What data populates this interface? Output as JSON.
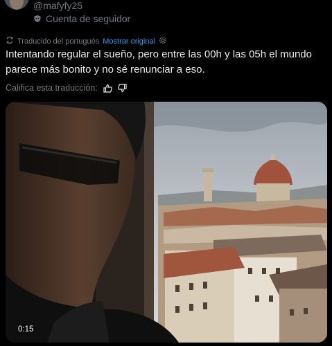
{
  "author": {
    "handle": "@mafyfy25",
    "badge": "Cuenta de seguidor"
  },
  "translation": {
    "note": "Traducido del portugués",
    "show_original": "Mostrar original",
    "rate_prompt": "Califica esta traducción:"
  },
  "tweet": {
    "text": "Intentando regular el sueño, pero entre las 00h y las 05h el mundo parece más bonito y no sé renunciar a eso."
  },
  "video": {
    "timestamp": "0:15"
  },
  "colors": {
    "background": "#000000",
    "text": "#e7e9ea",
    "muted": "#71767b",
    "link": "#1d9bf0"
  },
  "icons": {
    "follower": "follower-shield-icon",
    "translate": "translate-icon",
    "settings": "gear-icon",
    "thumb_up": "thumbs-up-icon",
    "thumb_down": "thumbs-down-icon"
  }
}
